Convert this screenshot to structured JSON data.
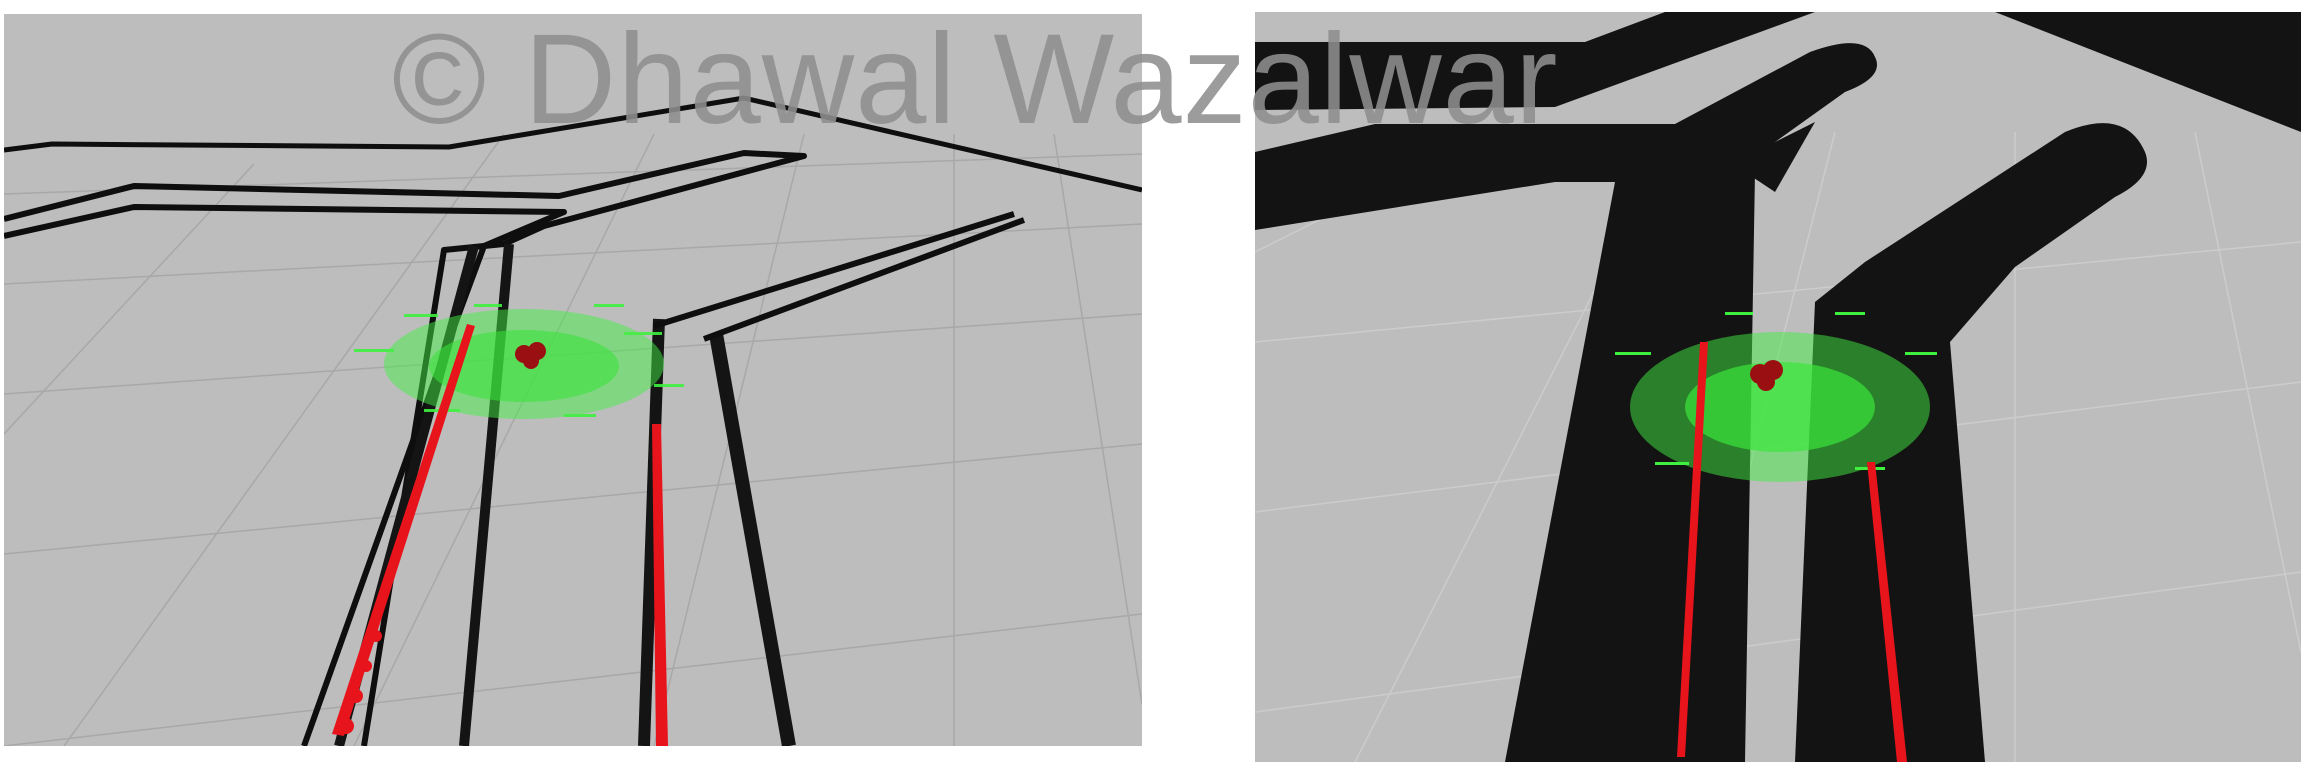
{
  "watermark": {
    "text": "© Dhawal Wazalwar"
  },
  "panels": [
    {
      "id": "left",
      "view": "occupancy-grid-map",
      "walls": "thin-black-outlines"
    },
    {
      "id": "right",
      "view": "costmap",
      "walls": "thick-inflated-black"
    }
  ],
  "colors": {
    "floor": "#bdbdbd",
    "grid": "#a9a9a9",
    "walls": "#111111",
    "laser_scan": "#e8141c",
    "particle_cloud": "#33ee33",
    "robot": "#9a0f12",
    "watermark": "#8f8f8f"
  }
}
